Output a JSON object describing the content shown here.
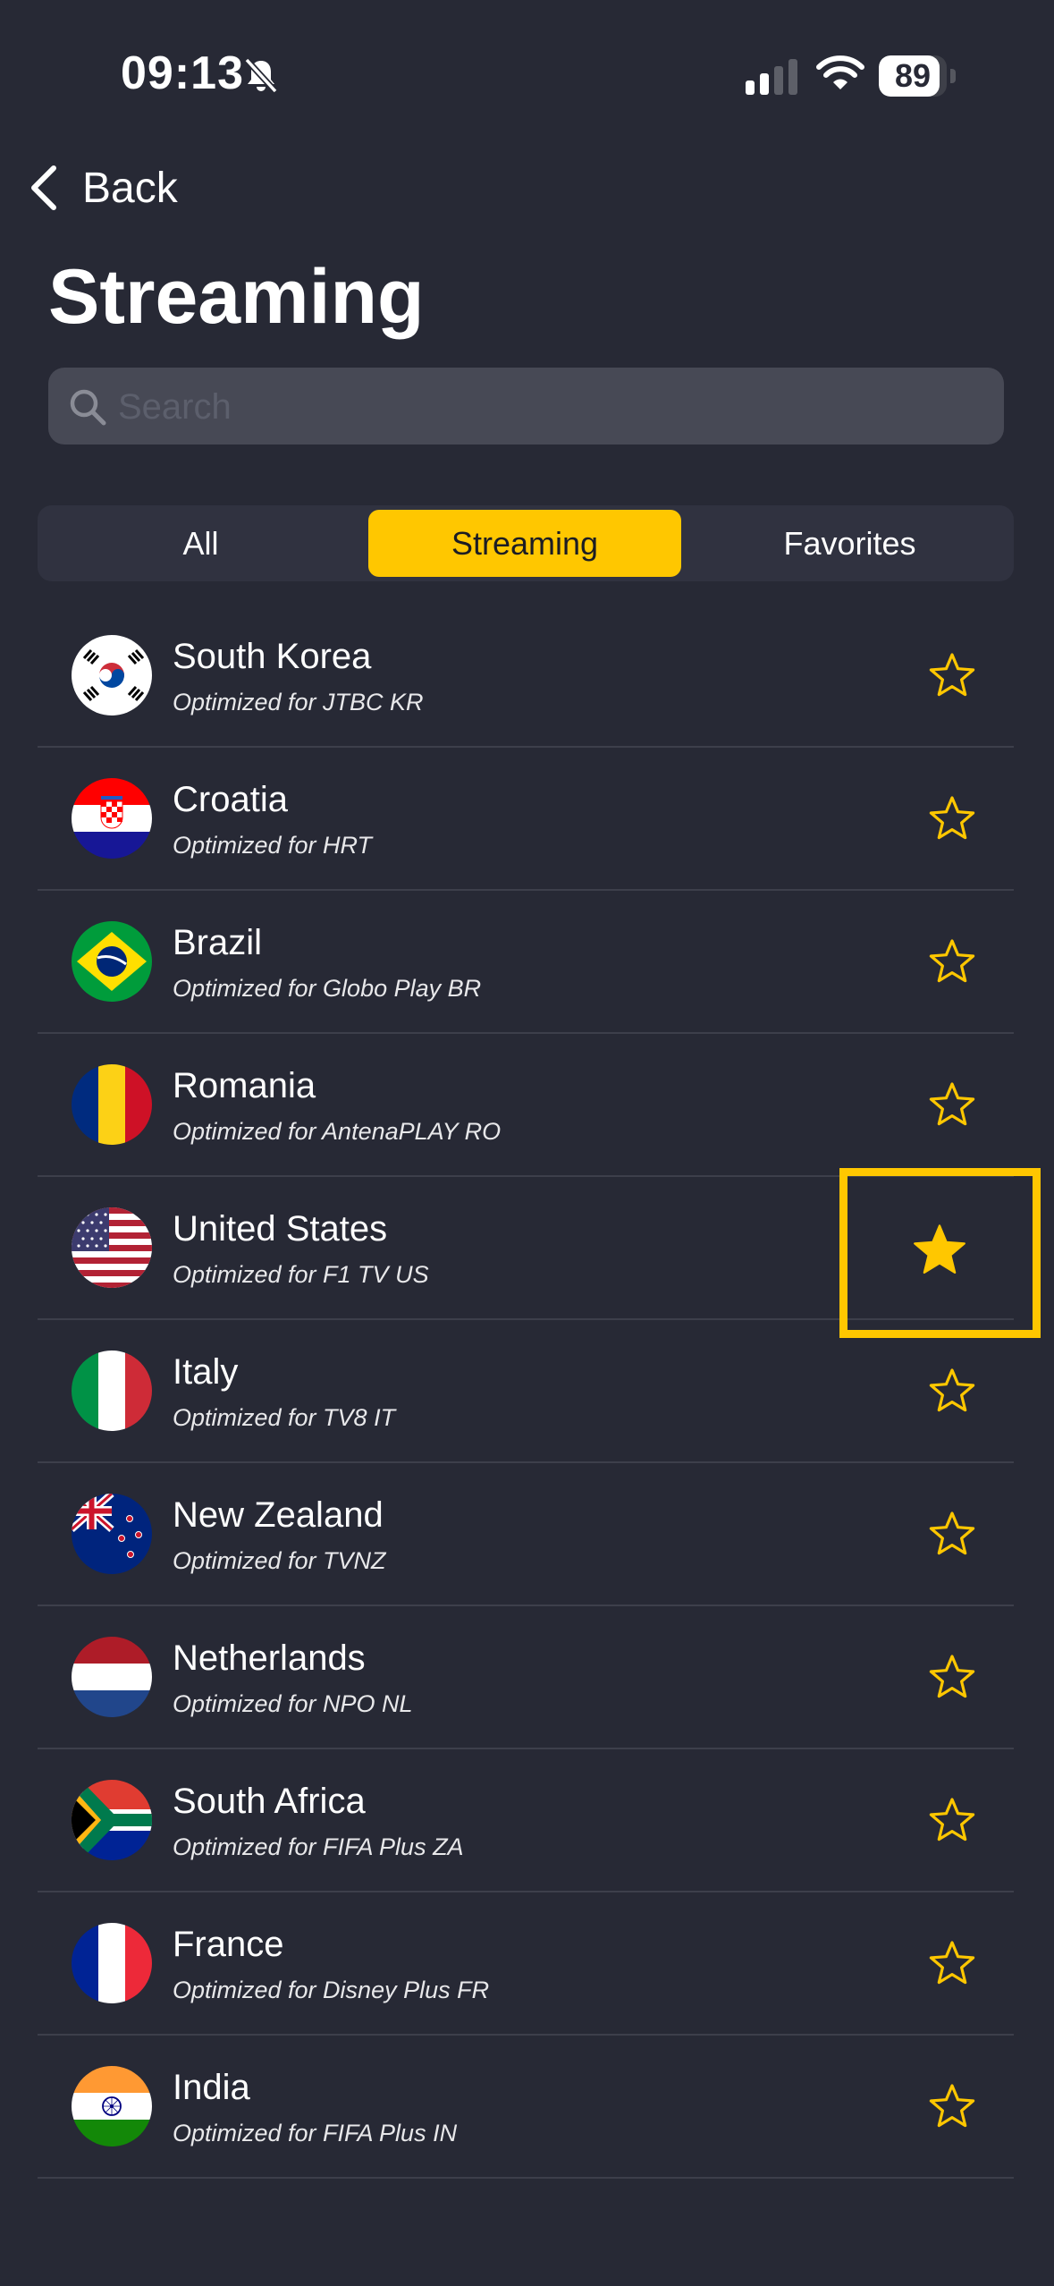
{
  "status_bar": {
    "time": "09:13",
    "battery": "89",
    "battery_level": 0.89
  },
  "nav": {
    "back_label": "Back"
  },
  "page": {
    "title": "Streaming"
  },
  "search": {
    "placeholder": "Search",
    "value": ""
  },
  "tabs": [
    {
      "label": "All",
      "active": false
    },
    {
      "label": "Streaming",
      "active": true
    },
    {
      "label": "Favorites",
      "active": false
    }
  ],
  "colors": {
    "background": "#272935",
    "accent": "#ffc700",
    "search_bg": "#474955",
    "divider": "#3d3f4b"
  },
  "locations": [
    {
      "country": "South Korea",
      "subtitle": "Optimized for JTBC KR",
      "flag": "flag-south-korea",
      "favorite": false
    },
    {
      "country": "Croatia",
      "subtitle": "Optimized for HRT",
      "flag": "flag-croatia",
      "favorite": false
    },
    {
      "country": "Brazil",
      "subtitle": "Optimized for Globo Play BR",
      "flag": "flag-brazil",
      "favorite": false
    },
    {
      "country": "Romania",
      "subtitle": "Optimized for AntenaPLAY RO",
      "flag": "flag-romania",
      "favorite": false
    },
    {
      "country": "United States",
      "subtitle": "Optimized for F1 TV US",
      "flag": "flag-united-states",
      "favorite": true
    },
    {
      "country": "Italy",
      "subtitle": "Optimized for TV8 IT",
      "flag": "flag-italy",
      "favorite": false
    },
    {
      "country": "New Zealand",
      "subtitle": "Optimized for TVNZ",
      "flag": "flag-new-zealand",
      "favorite": false
    },
    {
      "country": "Netherlands",
      "subtitle": "Optimized for NPO NL",
      "flag": "flag-netherlands",
      "favorite": false
    },
    {
      "country": "South Africa",
      "subtitle": "Optimized for FIFA Plus ZA",
      "flag": "flag-south-africa",
      "favorite": false
    },
    {
      "country": "France",
      "subtitle": "Optimized for Disney Plus FR",
      "flag": "flag-france",
      "favorite": false
    },
    {
      "country": "India",
      "subtitle": "Optimized for FIFA Plus IN",
      "flag": "flag-india",
      "favorite": false
    }
  ]
}
